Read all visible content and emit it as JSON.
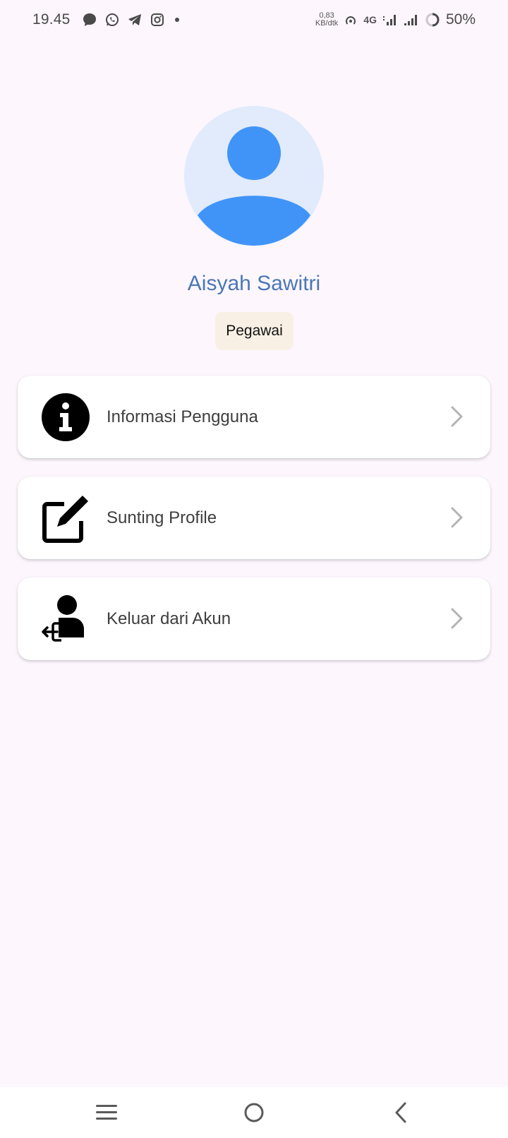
{
  "status_bar": {
    "time": "19.45",
    "net_speed_value": "0,83",
    "net_speed_unit": "KB/dtk",
    "network_type": "4G",
    "battery_percent": "50%",
    "notification_icons": [
      "chat-bubble-icon",
      "whatsapp-icon",
      "telegram-icon",
      "instagram-icon",
      "dot-icon"
    ]
  },
  "profile": {
    "name": "Aisyah Sawitri",
    "role": "Pegawai"
  },
  "menu": {
    "items": [
      {
        "label": "Informasi Pengguna",
        "icon": "info-icon"
      },
      {
        "label": "Sunting Profile",
        "icon": "edit-icon"
      },
      {
        "label": "Keluar dari Akun",
        "icon": "logout-user-icon"
      }
    ]
  },
  "colors": {
    "background": "#fdf6fd",
    "avatar_bg": "#e1ebfc",
    "avatar_fg": "#4194f7",
    "name_text": "#4a77b4",
    "badge_bg": "#f8f0e4"
  },
  "nav_bar": {
    "buttons": [
      "recent-apps-icon",
      "home-icon",
      "back-icon"
    ]
  }
}
